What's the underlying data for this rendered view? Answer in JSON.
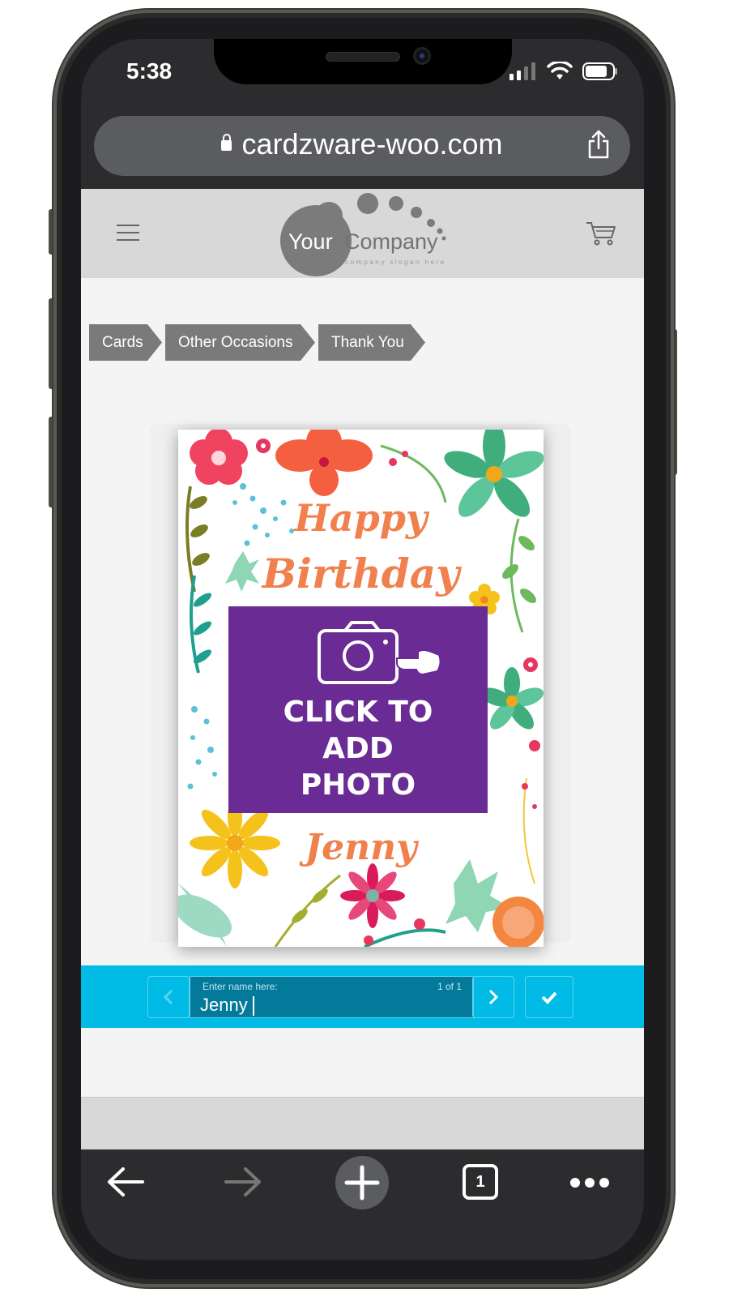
{
  "status_bar": {
    "time": "5:38",
    "icons": [
      "signal-bars-icon",
      "wifi-icon",
      "battery-icon"
    ]
  },
  "browser": {
    "url": "cardzware-woo.com",
    "toolbar_icons": [
      "back-arrow-icon",
      "forward-arrow-icon",
      "new-tab-plus-icon",
      "tabs-icon",
      "more-icon"
    ],
    "tab_count": "1"
  },
  "site": {
    "logo": {
      "your": "Your",
      "company": "Company",
      "slogan": "company slogan here"
    },
    "breadcrumbs": [
      "Cards",
      "Other Occasions",
      "Thank You"
    ]
  },
  "card": {
    "line1": "Happy",
    "line2": "Birthday",
    "photo_prompt": [
      "CLICK TO",
      "ADD",
      "PHOTO"
    ],
    "name": "Jenny"
  },
  "editor": {
    "field_label": "Enter name here:",
    "counter": "1 of 1",
    "value": "Jenny"
  },
  "colors": {
    "photo_box": "#6a2b94",
    "edit_bar": "#00bbe6",
    "card_text": "#f0804e",
    "breadcrumb": "#7a7a7a"
  }
}
